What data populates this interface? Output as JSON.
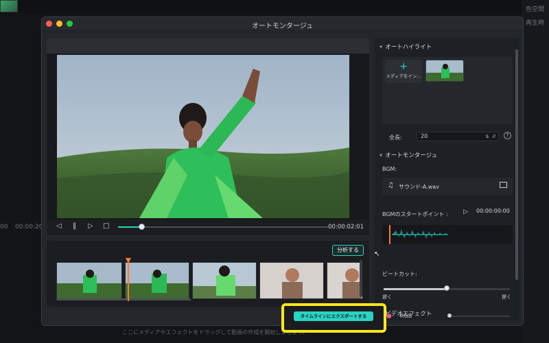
{
  "window": {
    "title": "オートモンタージュ"
  },
  "background": {
    "right_labels": [
      "色空間",
      "再生時"
    ],
    "timeline_times": [
      "00",
      "00:00:20"
    ],
    "hint": "ここにメディアやエフェクトをドラッグして動画の作成を開始しましょう。"
  },
  "preview": {
    "timecode": "00:00:02:01",
    "progress_fraction": 0.11
  },
  "clips": {
    "analyze_label": "分析する"
  },
  "auto_highlight": {
    "section_title": "オートハイライト",
    "add_media_label": "メディアをイン...",
    "length_label": "全長:",
    "length_value": "20",
    "length_unit": "s"
  },
  "auto_montage": {
    "section_title": "オートモンタージュ",
    "bgm_label": "BGM:",
    "bgm_file": "サウンド-A.wav",
    "start_point_label": "BGMのスタートポイント :",
    "start_point_value": "00:00:00:00",
    "beat_cut_label": "ビートカット:",
    "slow_left": "遅く",
    "slow_right": "遅く",
    "beat_fraction": 0.5
  },
  "video_effect": {
    "section_title": "ビデオエフェクト",
    "rgb_label": "RGB"
  },
  "export": {
    "label": "タイムラインにエクスポートする"
  },
  "colors": {
    "accent": "#27d3c1",
    "highlight": "#ffe81a",
    "playhead": "#ff7a2f"
  },
  "icons": [
    "prev-frame-icon",
    "pause-icon",
    "next-frame-icon",
    "stop-icon",
    "music-note-icon",
    "folder-icon",
    "play-icon",
    "help-icon",
    "add-icon",
    "stepper-icon",
    "rgb-icon"
  ]
}
